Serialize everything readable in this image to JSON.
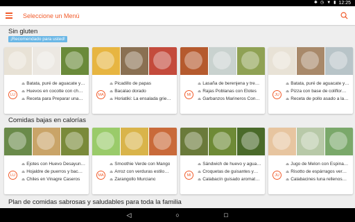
{
  "status": {
    "time": "12:25"
  },
  "app": {
    "title": "Seleccione un Menú"
  },
  "sections": [
    {
      "title": "Sin gluten",
      "badge": "¡Recomendado para usted!",
      "cards": [
        {
          "day": "LU",
          "meals": [
            "Batata, puré de aguacate y…",
            "Huevos en cocotte con ch…",
            "Receta para Preparar una…"
          ],
          "photos": [
            "#e8e2d6",
            "#ece8e2",
            "#6a8a3a"
          ]
        },
        {
          "day": "MA",
          "meals": [
            "Picadillo de papas",
            "Bacalao dorado",
            "Horiatiki: La ensalada grie…"
          ],
          "photos": [
            "#e7b541",
            "#8a7052",
            "#c44b3c"
          ]
        },
        {
          "day": "MI",
          "meals": [
            "Lasaña de berenjena y tre…",
            "Rajas Poblanas con Elotes",
            "Garbanzos Marineros Con…"
          ],
          "photos": [
            "#b55a2e",
            "#c9d2cf",
            "#8fa154"
          ]
        },
        {
          "day": "JU",
          "meals": [
            "Batata, puré de aguacate y…",
            "Pizza con base de coliflor…",
            "Receta de pollo asado a la…"
          ],
          "photos": [
            "#e8e2d6",
            "#a8896a",
            "#b8c4c8"
          ]
        }
      ]
    },
    {
      "title": "Comidas bajas en calorías",
      "badge": "",
      "cards": [
        {
          "day": "LU",
          "meals": [
            "Ejotes con Huevo Desayun…",
            "Hojaldre de puerros y bac…",
            "Chiles en Vinagre Caseros"
          ],
          "photos": [
            "#6a8a4a",
            "#c9a468",
            "#7a8a3a"
          ]
        },
        {
          "day": "MA",
          "meals": [
            "Smoothie Verde con Mango",
            "Arroz con verduras estilo…",
            "Zarangollo Murciano"
          ],
          "photos": [
            "#9acb6a",
            "#d9b44a",
            "#c96a3a"
          ]
        },
        {
          "day": "MI",
          "meals": [
            "Sándwich de huevo y agua…",
            "Croquetas de guisantes y…",
            "Calabacín guisado aromat…"
          ],
          "photos": [
            "#6a7a3a",
            "#6e8a36",
            "#4a6a2a"
          ]
        },
        {
          "day": "JU",
          "meals": [
            "Jugo de Melon con Espina…",
            "Risotto de espárragos ver…",
            "Calabacines luna rellenos…"
          ],
          "photos": [
            "#e7c5a0",
            "#b8c9a8",
            "#7aa86a"
          ]
        }
      ]
    },
    {
      "title": "Plan de comidas sabrosas y saludables para toda la familia",
      "badge": "",
      "cards": []
    }
  ],
  "icons": {
    "menu": "hamburger-menu-icon",
    "search": "search-icon",
    "meal": "cloche-icon",
    "back": "back-triangle-icon",
    "home": "home-circle-icon",
    "recents": "recents-square-icon"
  },
  "colors": {
    "accent": "#f15a29",
    "badge": "#6ab7e6",
    "background": "#eeeeee"
  }
}
